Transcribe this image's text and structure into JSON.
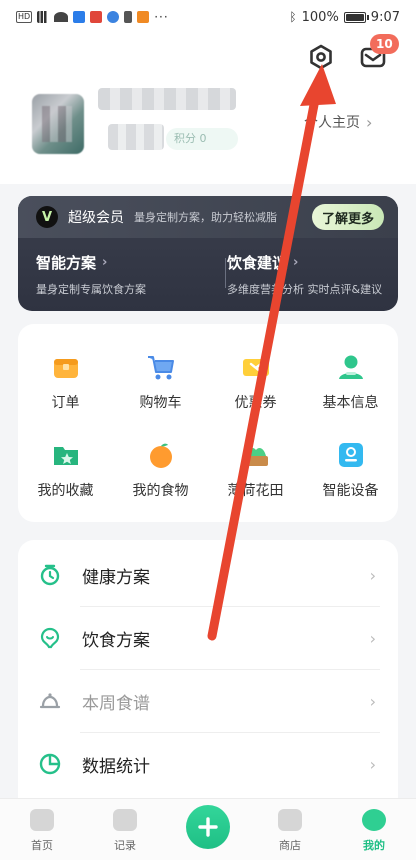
{
  "status_bar": {
    "battery": "100%",
    "time": "9:07",
    "battery_level": 1.0
  },
  "header": {
    "message_count": "10",
    "points_label": "积分 0",
    "profile_link": "个人主页"
  },
  "vip": {
    "title": "超级会员",
    "desc": "量身定制方案，助力轻松减脂",
    "more_button": "了解更多",
    "items": [
      {
        "title": "智能方案",
        "desc": "量身定制专属饮食方案"
      },
      {
        "title": "饮食建议",
        "desc": "多维度营养分析 实时点评&建议"
      }
    ]
  },
  "grid": {
    "items": [
      {
        "label": "订单",
        "icon": "order-icon"
      },
      {
        "label": "购物车",
        "icon": "cart-icon"
      },
      {
        "label": "优惠券",
        "icon": "coupon-icon"
      },
      {
        "label": "基本信息",
        "icon": "profile-info-icon"
      },
      {
        "label": "我的收藏",
        "icon": "favorites-icon"
      },
      {
        "label": "我的食物",
        "icon": "food-icon"
      },
      {
        "label": "薄荷花田",
        "icon": "garden-icon"
      },
      {
        "label": "智能设备",
        "icon": "smart-device-icon"
      }
    ]
  },
  "list": {
    "items": [
      {
        "label": "健康方案",
        "icon": "health-plan-icon"
      },
      {
        "label": "饮食方案",
        "icon": "diet-plan-icon"
      },
      {
        "label": "本周食谱",
        "icon": "weekly-recipe-icon"
      },
      {
        "label": "数据统计",
        "icon": "statistics-icon"
      }
    ]
  },
  "bottom_nav": {
    "items": [
      {
        "label": "首页"
      },
      {
        "label": "记录"
      },
      {
        "label": "商店"
      },
      {
        "label": "我的"
      }
    ]
  },
  "colors": {
    "accent_green": "#1fbf85",
    "badge_red": "#f26c5b",
    "annotation_arrow": "#e8452f",
    "vip_bg": "#333745"
  }
}
